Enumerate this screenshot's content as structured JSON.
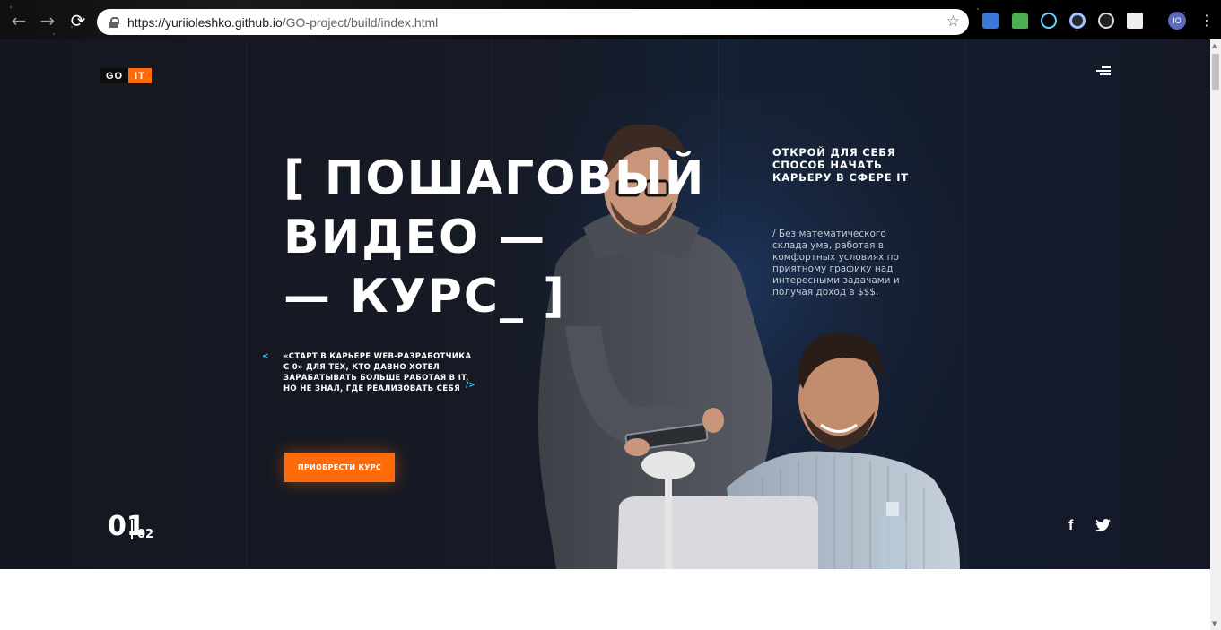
{
  "browser": {
    "url_host": "https://yuriioleshko.github.io",
    "url_path": "/GO-project/build/index.html",
    "back_icon": "back-arrow",
    "forward_icon": "forward-arrow",
    "reload_icon": "reload",
    "bookmark_icon": "star",
    "profile_initials": "IO"
  },
  "header": {
    "logo_go": "GO",
    "logo_it": "IT",
    "menu_icon": "hamburger-menu"
  },
  "hero": {
    "headline_line1": "[ ПОШАГОВЫЙ",
    "headline_line2": "ВИДЕО —",
    "headline_line3": "— КУРС_ ]",
    "quote": "«СТАРТ В КАРЬЕРЕ WEB-РАЗРАБОТЧИКА С 0» ДЛЯ ТЕХ, КТО ДАВНО ХОТЕЛ ЗАРАБАТЫВАТЬ БОЛЬШЕ РАБОТАЯ В IT, НО НЕ ЗНАЛ, ГДЕ РЕАЛИЗОВАТЬ СЕБЯ",
    "quote_open": "<",
    "quote_close": "/>",
    "cta_label": "ПРИОБРЕСТИ КУРС",
    "right_title": "ОТКРОЙ ДЛЯ СЕБЯ СПОСОБ НАЧАТЬ КАРЬЕРУ В СФЕРЕ IT",
    "right_text": "/ Без математического склада ума, работая в комфортных условиях по приятному графику над интересными задачами и получая доход в $$$.",
    "pager_current": "01",
    "pager_total": "02"
  },
  "social": {
    "facebook": "f",
    "twitter_icon": "twitter-bird"
  },
  "colors": {
    "accent": "#ff6b08",
    "background": "#161a26",
    "arrow_accent": "#3ad4ff"
  }
}
